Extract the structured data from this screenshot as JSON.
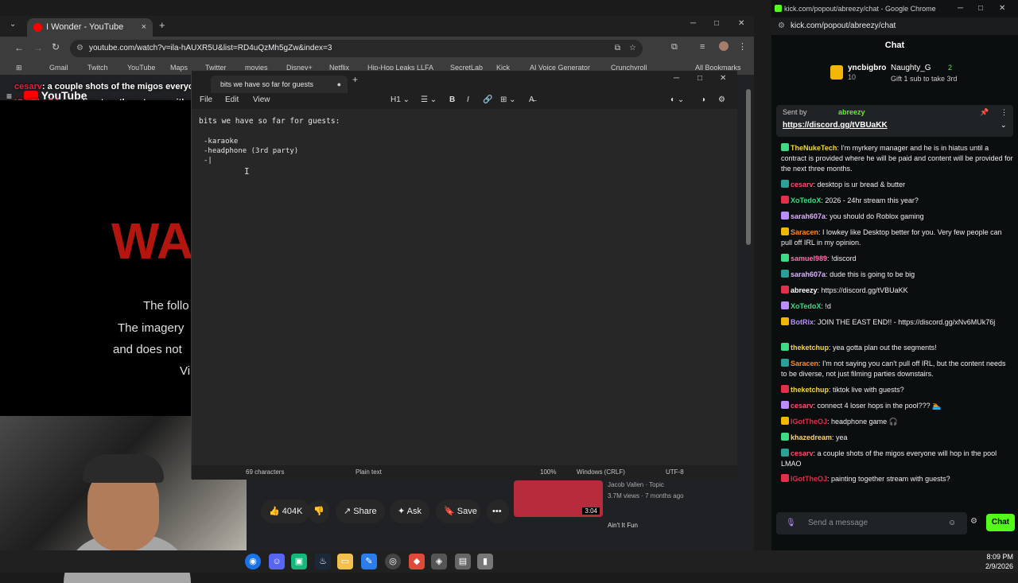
{
  "youtube_chrome": {
    "tab_title": "I Wonder - YouTube",
    "url": "youtube.com/watch?v=ila-hAUXR5U&list=RD4uQzMh5gZw&index=3",
    "bookmarks": [
      "Gmail",
      "Twitch",
      "YouTube",
      "Maps",
      "Twitter",
      "movies",
      "Disney+",
      "Netflix",
      "Hip-Hop Leaks LLFA",
      "SecretLab",
      "Kick",
      "AI Voice Generator",
      "Crunchyroll",
      "All Bookmarks"
    ],
    "logo": "YouTube",
    "video_text": {
      "big": "WA",
      "lines": [
        "The follo",
        "The imagery",
        "and does not",
        "Vi"
      ]
    },
    "overlay_chat": [
      {
        "name": "cesarv",
        "text": ": a couple shots of the migos everyone will hop in the pool LMAO"
      },
      {
        "name": "IGotTheOJ",
        "text": ": painting together stream with guests?"
      }
    ],
    "actions": {
      "likes": "404K",
      "share": "Share",
      "ask": "Ask",
      "save": "Save"
    },
    "related": {
      "channel": "Jacob Vallen · Topic",
      "meta": "3.7M views · 7 months ago",
      "duration": "3:04",
      "next_title": "Ain't It Fun"
    }
  },
  "notepad": {
    "tab_title": "bits we have so far for guests",
    "menu": [
      "File",
      "Edit",
      "View"
    ],
    "toolbar": {
      "heading": "H1"
    },
    "lines": [
      "bits we have so far for guests:",
      "",
      "-karaoke",
      "-headphone (3rd party)",
      "-|"
    ],
    "status": {
      "characters": "69 characters",
      "format": "Plain text",
      "zoom": "100%",
      "line_ending": "Windows (CRLF)",
      "encoding": "UTF-8"
    }
  },
  "kick": {
    "window_title": "kick.com/popout/abreezy/chat - Google Chrome",
    "url": "kick.com/popout/abreezy/chat",
    "header": "Chat",
    "gifters": [
      {
        "name": "yncbigbro",
        "count": "10"
      },
      {
        "name": "Naughty_G",
        "count": "2"
      }
    ],
    "gift_note": "Gift 1 sub to take 3rd",
    "pinned": {
      "label": "Sent by",
      "by": "abreezy",
      "link": "https://discord.gg/tVBUaKK"
    },
    "messages": [
      {
        "user": "TheNukeTech",
        "color": "#f5d742",
        "text": "I'm myrkery manager and he is in hiatus until a contract is provided where he will be paid and content will be provided for the next three months."
      },
      {
        "user": "cesarv",
        "color": "#ff4d6d",
        "text": "desktop is ur bread & butter"
      },
      {
        "user": "XoTedoX",
        "color": "#3ddc84",
        "text": "2026 - 24hr stream this year?"
      },
      {
        "user": "sarah607a",
        "color": "#e0b0ff",
        "text": "you should do Roblox gaming"
      },
      {
        "user": "Saracen",
        "color": "#ff8c1a",
        "text": "I lowkey like Desktop better for you. Very few people can pull off IRL in my opinion."
      },
      {
        "user": "samuel989",
        "color": "#ff6fb0",
        "text": "!discord"
      },
      {
        "user": "sarah607a",
        "color": "#e0b0ff",
        "text": "dude this is going to be big"
      },
      {
        "user": "abreezy",
        "color": "#ffffff",
        "text": "https://discord.gg/tVBUaKK"
      },
      {
        "user": "XoTedoX",
        "color": "#3ddc84",
        "text": "!d"
      },
      {
        "user": "BotRix",
        "color": "#b98cff",
        "text": "JOIN THE EAST END!! - https://discord.gg/xNv6MUk76j"
      },
      {
        "user": "theketchup",
        "color": "#f5d742",
        "text": "yea gotta plan out the segments!"
      },
      {
        "user": "Saracen",
        "color": "#ff8c1a",
        "text": "I'm not saying you can't pull off IRL, but the content needs to be diverse, not just filming parties downstairs."
      },
      {
        "user": "theketchup",
        "color": "#f5d742",
        "text": "tiktok live with guests?"
      },
      {
        "user": "cesarv",
        "color": "#ff4d6d",
        "text": "connect 4 loser hops in the pool??? 🏊"
      },
      {
        "user": "IGotTheOJ",
        "color": "#e0304a",
        "text": "headphone game 🎧"
      },
      {
        "user": "khazedream",
        "color": "#ffd36e",
        "text": "yea"
      },
      {
        "user": "cesarv",
        "color": "#ff4d6d",
        "text": "a couple shots of the migos everyone will hop in the pool LMAO"
      },
      {
        "user": "IGotTheOJ",
        "color": "#e0304a",
        "text": "painting together stream with guests?"
      }
    ],
    "input_placeholder": "Send a message",
    "chat_button": "Chat"
  },
  "taskbar": {
    "time": "8:09 PM",
    "date": "2/9/2026"
  }
}
